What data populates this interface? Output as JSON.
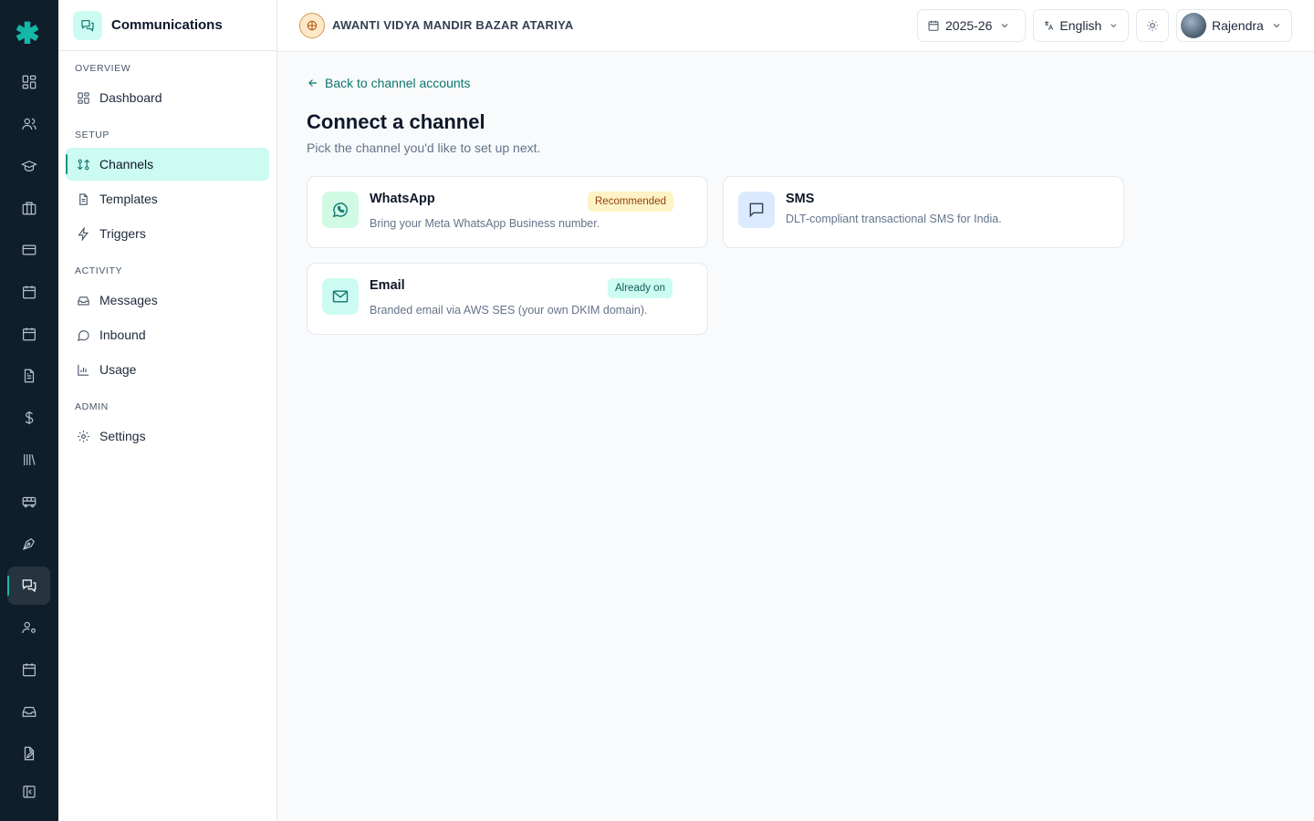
{
  "rail": {
    "items": [
      {
        "icon": "dashboard-icon"
      },
      {
        "icon": "users-icon"
      },
      {
        "icon": "graduation-cap-icon"
      },
      {
        "icon": "building-icon"
      },
      {
        "icon": "credit-card-icon"
      },
      {
        "icon": "calendar-icon"
      },
      {
        "icon": "calendar-check-icon"
      },
      {
        "icon": "file-text-icon"
      },
      {
        "icon": "dollar-icon"
      },
      {
        "icon": "library-icon"
      },
      {
        "icon": "bus-icon"
      },
      {
        "icon": "pen-tool-icon"
      },
      {
        "icon": "messages-icon",
        "active": true
      },
      {
        "icon": "user-cog-icon"
      },
      {
        "icon": "calendar-grid-icon"
      },
      {
        "icon": "inbox-icon"
      },
      {
        "icon": "file-edit-icon"
      },
      {
        "icon": "collapse-sidebar-icon"
      }
    ]
  },
  "sidebar": {
    "title": "Communications",
    "sections": {
      "overview": "OVERVIEW",
      "setup": "SETUP",
      "activity": "ACTIVITY",
      "admin": "ADMIN"
    },
    "items": {
      "dashboard": "Dashboard",
      "channels": "Channels",
      "templates": "Templates",
      "triggers": "Triggers",
      "messages": "Messages",
      "inbound": "Inbound",
      "usage": "Usage",
      "settings": "Settings"
    },
    "active": "channels"
  },
  "topbar": {
    "school_name": "AWANTI VIDYA MANDIR BAZAR ATARIYA",
    "year": "2025-26",
    "language": "English",
    "user": "Rajendra"
  },
  "main": {
    "back_link": "Back to channel accounts",
    "title": "Connect a channel",
    "subtitle": "Pick the channel you'd like to set up next.",
    "channels": {
      "whatsapp": {
        "name": "WhatsApp",
        "description": "Bring your Meta WhatsApp Business number.",
        "badge": "Recommended"
      },
      "sms": {
        "name": "SMS",
        "description": "DLT-compliant transactional SMS for India."
      },
      "email": {
        "name": "Email",
        "description": "Branded email via AWS SES (your own DKIM domain).",
        "badge": "Already on"
      }
    }
  },
  "colors": {
    "accent": "#0d9488",
    "rail_bg": "#0f1e2b",
    "active_bg": "#ccfbf1",
    "recommended_bg": "#fef3c7",
    "already_on_bg": "#ccfbf1"
  }
}
